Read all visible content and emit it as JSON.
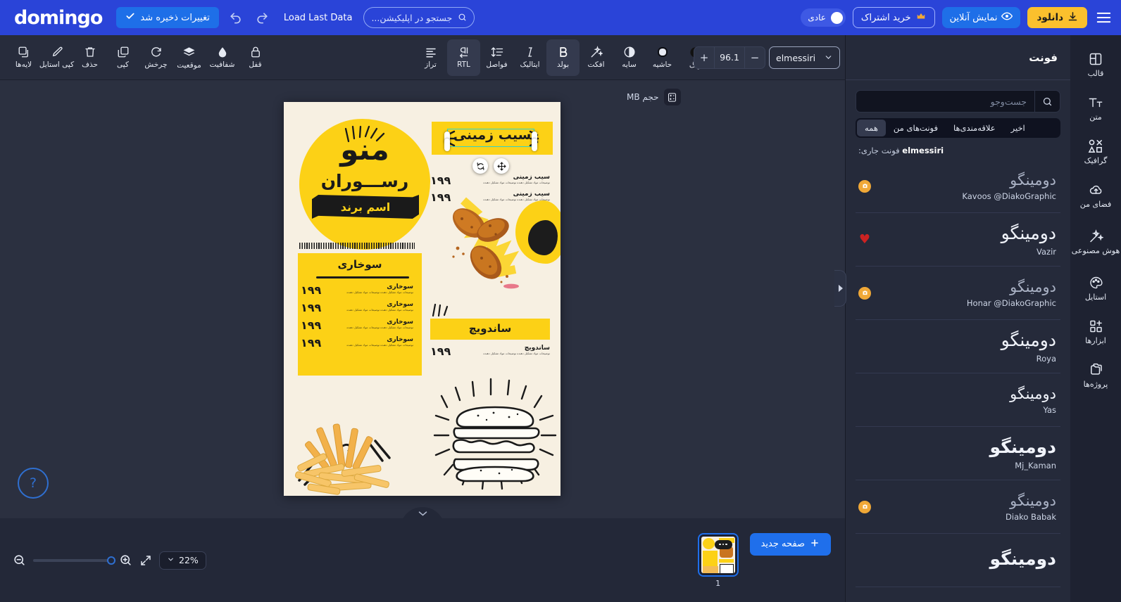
{
  "topbar": {
    "logo": "domingo",
    "saved_label": "تغییرات ذخیره شد",
    "undo_icon": "undo-icon",
    "redo_icon": "redo-icon",
    "load_last_data": "Load Last Data",
    "search_placeholder": "جستجو در اپلیکیشن...",
    "mode_label": "عادی",
    "subscribe_label": "خرید اشتراک",
    "preview_label": "نمایش آنلاین",
    "download_label": "دانلود",
    "menu_icon": "hamburger-menu-icon"
  },
  "toolbar": {
    "left_tools": [
      {
        "label": "لایه‌ها",
        "icon": "layers-icon"
      },
      {
        "label": "کپی استایل",
        "icon": "brush-icon"
      },
      {
        "label": "حذف",
        "icon": "trash-icon"
      },
      {
        "label": "کپی",
        "icon": "copy-icon"
      },
      {
        "label": "چرخش",
        "icon": "rotate-icon"
      },
      {
        "label": "موقعیت",
        "icon": "position-icon"
      },
      {
        "label": "شفافیت",
        "icon": "opacity-icon"
      },
      {
        "label": "قفل",
        "icon": "lock-icon"
      }
    ],
    "text_tools": [
      {
        "label": "تراز",
        "icon": "align-icon",
        "active": false
      },
      {
        "label": "RTL",
        "icon": "rtl-icon",
        "active": true
      },
      {
        "label": "فواصل",
        "icon": "spacing-icon",
        "active": false
      },
      {
        "label": "ایتالیک",
        "icon": "italic-icon",
        "active": false
      },
      {
        "label": "بولد",
        "icon": "bold-icon",
        "active": true
      },
      {
        "label": "افکت",
        "icon": "effects-icon",
        "active": false
      },
      {
        "label": "سایه",
        "icon": "shadow-icon",
        "active": false
      },
      {
        "label": "حاشیه",
        "icon": "outline-icon",
        "active": false
      },
      {
        "label": "رنگ",
        "icon": "color-icon",
        "active": false
      }
    ],
    "font_size": "96.1",
    "minus_icon": "minus-icon",
    "plus_icon": "plus-icon",
    "font_name": "elmessiri",
    "font_chevron_icon": "chevron-down-icon"
  },
  "canvas": {
    "size_label": "حجم MB",
    "size_icon": "calculator-icon",
    "help_icon": "question-mark-icon",
    "collapse_icon": "chevron-down-icon",
    "selection": {
      "rotate_icon": "rotate-handle-icon",
      "move_icon": "move-handle-icon",
      "border_color": "#2fd3c8"
    },
    "poster": {
      "menu_word": "منو",
      "restaurant_word": "رســـوران",
      "brand_ribbon": "اسم برند",
      "fried_section_title": "سوخاری",
      "potato_section_title": "سیب زمینی",
      "sandwich_section_title": "ساندویچ",
      "potato_items": [
        {
          "name": "سیب زمینی",
          "desc": "توضیحات مواد تشکیل دهنده توضیحات مواد تشکیل دهنده",
          "price": "۱۹۹"
        },
        {
          "name": "سیب زمینی",
          "desc": "توضیحات مواد تشکیل دهنده توضیحات مواد تشکیل دهنده",
          "price": "۱۹۹"
        }
      ],
      "fried_items": [
        {
          "name": "سوخاری",
          "desc": "توضیحات مواد تشکیل دهنده توضیحات مواد تشکیل دهنده",
          "price": "۱۹۹"
        },
        {
          "name": "سوخاری",
          "desc": "توضیحات مواد تشکیل دهنده توضیحات مواد تشکیل دهنده",
          "price": "۱۹۹"
        },
        {
          "name": "سوخاری",
          "desc": "توضیحات مواد تشکیل دهنده توضیحات مواد تشکیل دهنده",
          "price": "۱۹۹"
        },
        {
          "name": "سوخاری",
          "desc": "توضیحات مواد تشکیل دهنده توضیحات مواد تشکیل دهنده",
          "price": "۱۹۹"
        }
      ],
      "sandwich_items": [
        {
          "name": "ساندویچ",
          "desc": "توضیحات مواد تشکیل دهنده توضیحات مواد تشکیل دهنده",
          "price": "۱۹۹"
        }
      ]
    }
  },
  "right_panel": {
    "title": "فونت",
    "search_placeholder": "جست‌وجو",
    "search_value": "",
    "search_icon": "search-icon",
    "tabs": [
      {
        "label": "همه",
        "active": true
      },
      {
        "label": "فونت‌های من",
        "active": false
      },
      {
        "label": "علاقه‌مندی‌ها",
        "active": false
      },
      {
        "label": "اخیر",
        "active": false
      }
    ],
    "current_font_label": "فونت جاری:",
    "current_font_value": "elmessiri",
    "sample_text": "دومینگو",
    "fonts": [
      {
        "name": "Kavoos @DiakoGraphic",
        "badge": "premium",
        "style": "muted"
      },
      {
        "name": "Vazir",
        "badge": "favorite",
        "style": "plain"
      },
      {
        "name": "Honar @DiakoGraphic",
        "badge": "premium",
        "style": "muted"
      },
      {
        "name": "Roya",
        "badge": "none",
        "style": "plain"
      },
      {
        "name": "Yas",
        "badge": "none",
        "style": "plain"
      },
      {
        "name": "Mj_Kaman",
        "badge": "none",
        "style": "bold"
      },
      {
        "name": "Diako Babak",
        "badge": "premium",
        "style": "muted"
      },
      {
        "name": "",
        "badge": "none",
        "style": "bold"
      }
    ],
    "collapse_icon": "chevron-right-icon"
  },
  "rail": {
    "items": [
      {
        "label": "قالب",
        "icon": "template-icon",
        "active": true
      },
      {
        "label": "متن",
        "icon": "text-icon",
        "active": false
      },
      {
        "label": "گرافیک",
        "icon": "graphics-icon",
        "active": false
      },
      {
        "label": "فضای من",
        "icon": "cloud-upload-icon",
        "active": false
      },
      {
        "label": "هوش مصنوعی",
        "icon": "magic-wand-icon",
        "active": false
      },
      {
        "label": "استایل",
        "icon": "palette-icon",
        "active": false
      },
      {
        "label": "ابزارها",
        "icon": "tools-grid-icon",
        "active": false
      },
      {
        "label": "پروژه‌ها",
        "icon": "projects-folder-icon",
        "active": false
      }
    ]
  },
  "bottombar": {
    "zoom_value": "22%",
    "zoom_chevron_icon": "chevron-down-icon",
    "fit_icon": "fit-screen-icon",
    "zoom_in_icon": "zoom-in-icon",
    "zoom_out_icon": "zoom-out-icon",
    "slider_percent": 100,
    "new_page_label": "صفحه جدید",
    "new_page_icon": "plus-icon",
    "page_thumb_number": "1",
    "thumb_menu_icon": "more-dots-icon"
  },
  "colors": {
    "brand_blue": "#2a44d8",
    "accent_blue": "#1f6feb",
    "download_yellow": "#fbc02d",
    "panel_bg": "#252a3a",
    "rail_bg": "#1e2231",
    "canvas_bg": "#2b3040",
    "poster_cream": "#f7f0e2",
    "poster_yellow": "#fcd116",
    "selection_teal": "#2fd3c8",
    "premium_orange": "#f0a837",
    "favorite_red": "#cc2222"
  }
}
